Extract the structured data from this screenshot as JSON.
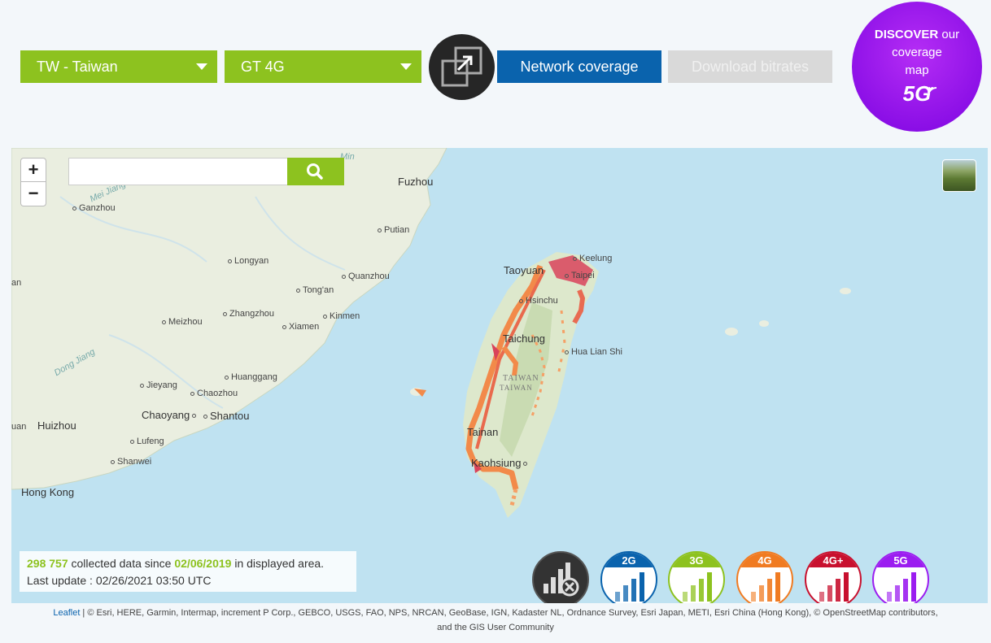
{
  "selectors": {
    "country": "TW - Taiwan",
    "network": "GT 4G"
  },
  "toolbar": {
    "fullscreen_icon": "expand-arrow-icon",
    "coverage_label": "Network coverage",
    "bitrates_label": "Download bitrates"
  },
  "discover": {
    "line1_bold": "DISCOVER",
    "line1_rest": " our",
    "line2": "coverage",
    "line3": "map",
    "badge": "5G"
  },
  "map": {
    "zoom_in": "+",
    "zoom_out": "−",
    "search_placeholder": "",
    "search_icon": "magnifier-icon",
    "places": [
      {
        "name": "Fuzhou",
        "size": "lg",
        "dot": false
      },
      {
        "name": "Ganzhou",
        "size": "sm",
        "dot": true
      },
      {
        "name": "Putian",
        "size": "sm",
        "dot": true
      },
      {
        "name": "Longyan",
        "size": "sm",
        "dot": true
      },
      {
        "name": "Quanzhou",
        "size": "sm",
        "dot": true
      },
      {
        "name": "Tong'an",
        "size": "sm",
        "dot": true
      },
      {
        "name": "Zhangzhou",
        "size": "sm",
        "dot": true
      },
      {
        "name": "Meizhou",
        "size": "sm",
        "dot": true
      },
      {
        "name": "Xiamen",
        "size": "sm",
        "dot": true
      },
      {
        "name": "Kinmen",
        "size": "sm",
        "dot": true
      },
      {
        "name": "Huanggang",
        "size": "sm",
        "dot": true
      },
      {
        "name": "Jieyang",
        "size": "sm",
        "dot": true
      },
      {
        "name": "Chaozhou",
        "size": "sm",
        "dot": true
      },
      {
        "name": "Chaoyang",
        "size": "lg",
        "dot": true
      },
      {
        "name": "Shantou",
        "size": "lg",
        "dot": true
      },
      {
        "name": "Huizhou",
        "size": "lg",
        "dot": false
      },
      {
        "name": "Lufeng",
        "size": "sm",
        "dot": true
      },
      {
        "name": "Shanwei",
        "size": "sm",
        "dot": true
      },
      {
        "name": "Hong Kong",
        "size": "lg",
        "dot": false
      },
      {
        "name": "Keelung",
        "size": "sm",
        "dot": true
      },
      {
        "name": "Taoyuan",
        "size": "lg",
        "dot": false
      },
      {
        "name": "Taipei",
        "size": "sm",
        "dot": true
      },
      {
        "name": "Hsinchu",
        "size": "sm",
        "dot": true
      },
      {
        "name": "Taichung",
        "size": "lg",
        "dot": false
      },
      {
        "name": "Hua Lian Shi",
        "size": "sm",
        "dot": true
      },
      {
        "name": "Tainan",
        "size": "lg",
        "dot": false
      },
      {
        "name": "Kaohsiung",
        "size": "lg",
        "dot": true
      },
      {
        "name": "an",
        "size": "sm",
        "dot": false
      },
      {
        "name": "uan",
        "size": "sm",
        "dot": false
      }
    ],
    "taiwan_label": "TAIWAN",
    "taiwan_sub": "TAIWAN",
    "river_labels": [
      "Mei Jiang",
      "Dong Jiang",
      "Min"
    ]
  },
  "info": {
    "count": "298 757",
    "text_mid": " collected data since ",
    "since_date": "02/06/2019",
    "text_end": " in displayed area.",
    "last_update": "Last update : 02/26/2021 03:50 UTC"
  },
  "tech_filters": [
    {
      "label": "",
      "icon": "signal-off-icon",
      "color": "#333333"
    },
    {
      "label": "2G",
      "icon": "signal-bars-icon",
      "color": "#0a63ad"
    },
    {
      "label": "3G",
      "icon": "signal-bars-icon",
      "color": "#8dc21f"
    },
    {
      "label": "4G",
      "icon": "signal-bars-icon",
      "color": "#f07b22"
    },
    {
      "label": "4G+",
      "icon": "signal-bars-icon",
      "color": "#c8102e"
    },
    {
      "label": "5G",
      "icon": "signal-bars-icon",
      "color": "#9b1df0"
    }
  ],
  "attribution": {
    "leaflet": "Leaflet",
    "text": " | © Esri, HERE, Garmin, Intermap, increment P Corp., GEBCO, USGS, FAO, NPS, NRCAN, GeoBase, IGN, Kadaster NL, Ordnance Survey, Esri Japan, METI, Esri China (Hong Kong), © OpenStreetMap contributors,",
    "line2": "and the GIS User Community"
  },
  "colors": {
    "accent_green": "#8dc21f",
    "accent_blue": "#0a63ad",
    "coverage_orange": "#f28a4a",
    "coverage_red": "#d9435a"
  }
}
